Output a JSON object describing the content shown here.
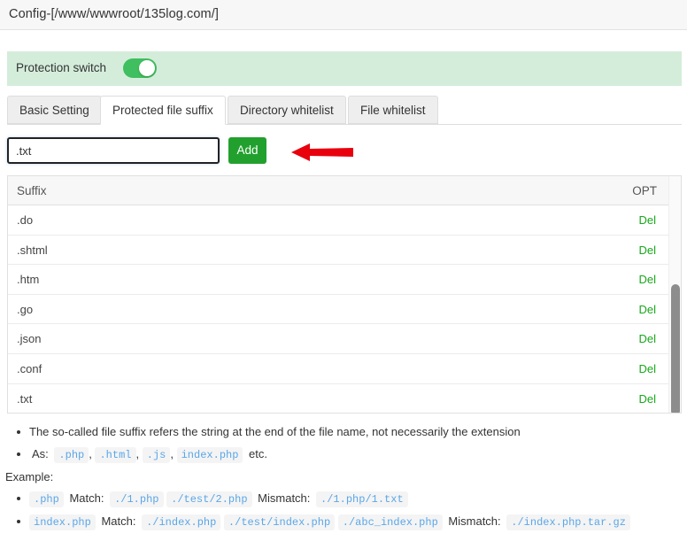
{
  "window": {
    "title": "Config-[/www/wwwroot/135log.com/]"
  },
  "protection": {
    "label": "Protection switch",
    "enabled": true,
    "banner_color": "#d4edda",
    "toggle_on_color": "#3fbf5f"
  },
  "tabs": [
    {
      "label": "Basic Setting",
      "active": false
    },
    {
      "label": "Protected file suffix",
      "active": true
    },
    {
      "label": "Directory whitelist",
      "active": false
    },
    {
      "label": "File whitelist",
      "active": false
    }
  ],
  "add_form": {
    "input_value": ".txt",
    "input_placeholder": "",
    "button_label": "Add",
    "button_color": "#22a02e"
  },
  "table": {
    "columns": [
      "Suffix",
      "OPT"
    ],
    "action_label": "Del",
    "action_color": "#17a81a",
    "rows": [
      {
        "suffix": ".do"
      },
      {
        "suffix": ".shtml"
      },
      {
        "suffix": ".htm"
      },
      {
        "suffix": ".go"
      },
      {
        "suffix": ".json"
      },
      {
        "suffix": ".conf"
      },
      {
        "suffix": ".txt"
      }
    ]
  },
  "notes": {
    "line1": "The so-called file suffix refers the string at the end of the file name, not necessarily the extension",
    "as_prefix": "As:",
    "as_codes": [
      ".php",
      ".html",
      ".js",
      "index.php"
    ],
    "as_suffix": "etc.",
    "example_label": "Example:",
    "example1": {
      "token": ".php",
      "match_label": "Match:",
      "matches": [
        "./1.php",
        "./test/2.php"
      ],
      "mismatch_label": "Mismatch:",
      "mismatches": [
        "./1.php/1.txt"
      ]
    },
    "example2": {
      "token": "index.php",
      "match_label": "Match:",
      "matches": [
        "./index.php",
        "./test/index.php",
        "./abc_index.php"
      ],
      "mismatch_label": "Mismatch:",
      "mismatches": [
        "./index.php.tar.gz"
      ]
    }
  },
  "annotations": {
    "arrow_color": "#e8000d",
    "arrow1_target": "add-button",
    "arrow2_target": "row-txt"
  }
}
